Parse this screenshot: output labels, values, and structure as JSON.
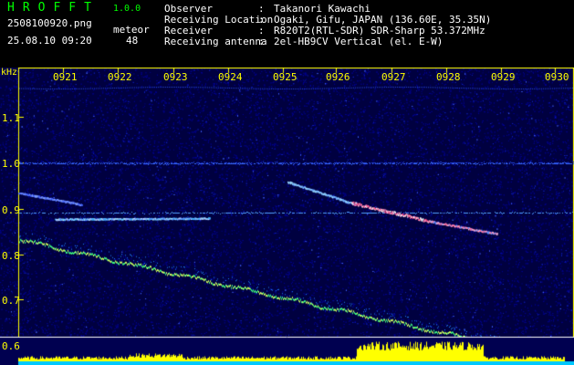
{
  "header": {
    "brand": "HROFFT",
    "version": "1.0.0",
    "filename": "2508100920.png",
    "timestamp": "25.08.10 09:20",
    "meteor_label": "meteor",
    "meteor_count": "48",
    "fields": [
      {
        "label": "Observer",
        "value": "Takanori Kawachi"
      },
      {
        "label": "Receiving Location",
        "value": "Ogaki, Gifu, JAPAN (136.60E, 35.35N)"
      },
      {
        "label": "Receiver",
        "value": "R820T2(RTL-SDR) SDR-Sharp 53.372MHz"
      },
      {
        "label": "Receiving antenna",
        "value": "2el-HB9CV Vertical (el. E-W)"
      }
    ],
    "separator": ":"
  },
  "axes": {
    "y_unit": "kHz",
    "x_ticks": [
      "0921",
      "0922",
      "0923",
      "0924",
      "0925",
      "0926",
      "0927",
      "0928",
      "0929",
      "0930"
    ],
    "y_ticks": [
      "1.1",
      "1.0",
      "0.9",
      "0.8",
      "0.7",
      "0.6"
    ]
  },
  "colors": {
    "label": "#ffff00",
    "text": "#ffffff",
    "brand": "#00ff00",
    "background": "#000000",
    "noise": "#000070",
    "meteor_trail": "#ff6fa0",
    "baseline": "#40ff80"
  }
}
